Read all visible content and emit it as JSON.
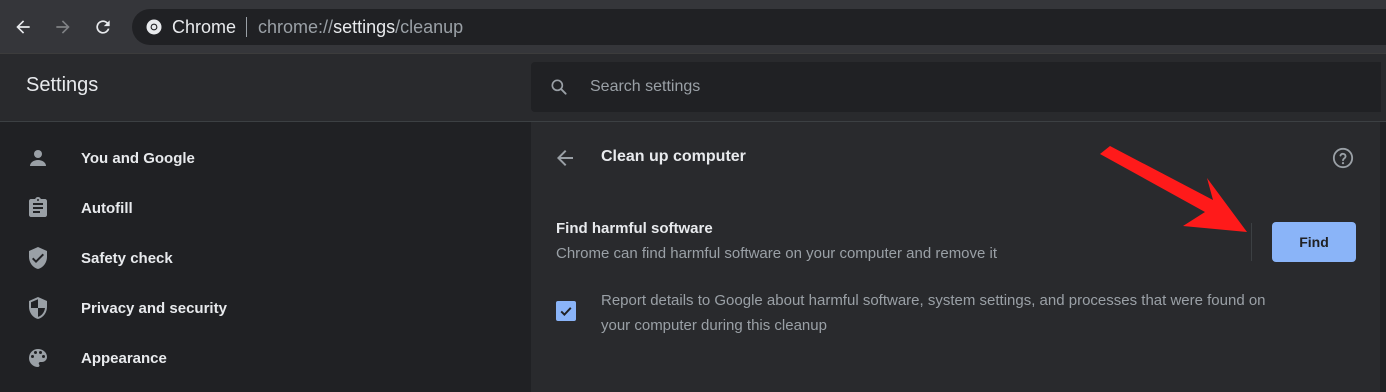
{
  "browser": {
    "back_icon": "arrow-left-icon",
    "forward_icon": "arrow-right-icon",
    "reload_icon": "reload-icon",
    "site_chip": "Chrome",
    "url_scheme": "chrome://",
    "url_host": "settings",
    "url_path": "/cleanup"
  },
  "header": {
    "title": "Settings",
    "search_placeholder": "Search settings"
  },
  "sidebar": {
    "items": [
      {
        "label": "You and Google",
        "icon": "person-icon"
      },
      {
        "label": "Autofill",
        "icon": "clipboard-icon"
      },
      {
        "label": "Safety check",
        "icon": "shield-check-icon"
      },
      {
        "label": "Privacy and security",
        "icon": "shield-icon"
      },
      {
        "label": "Appearance",
        "icon": "palette-icon"
      }
    ]
  },
  "main": {
    "title": "Clean up computer",
    "find_title": "Find harmful software",
    "find_description": "Chrome can find harmful software on your computer and remove it",
    "find_button": "Find",
    "report_checked": true,
    "report_line1": "Report details to Google about harmful software, system settings, and processes that were found on",
    "report_line2": "your computer during this cleanup"
  },
  "colors": {
    "accent": "#8ab4f8",
    "annotation_arrow": "#ff0000"
  }
}
